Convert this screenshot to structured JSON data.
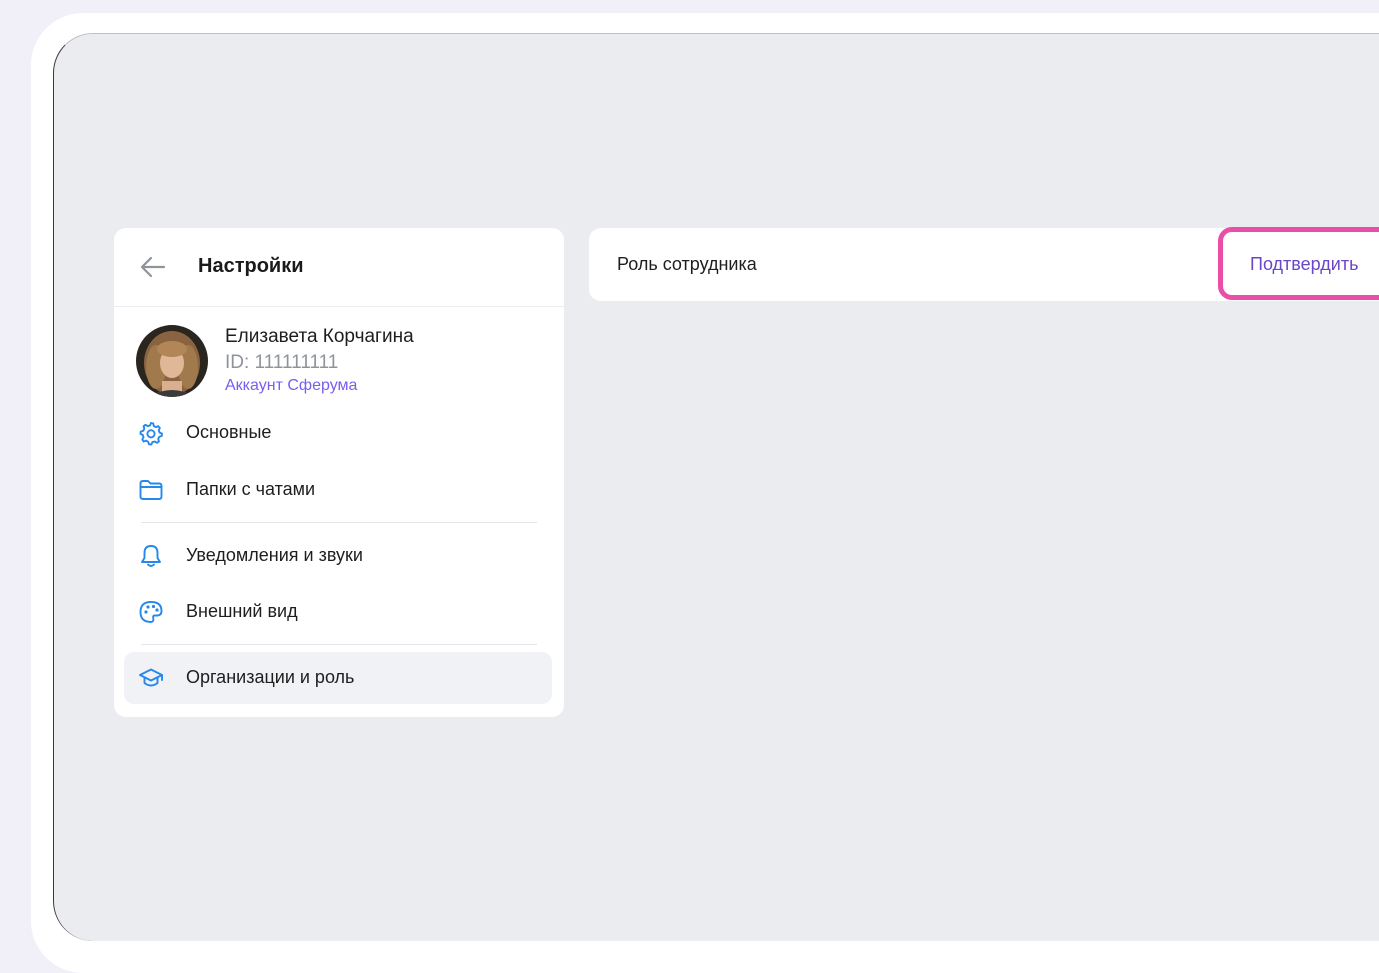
{
  "settings": {
    "title": "Настройки",
    "profile": {
      "name": "Елизавета Корчагина",
      "id": "ID: 111111111",
      "account": "Аккаунт Сферума"
    },
    "menu": [
      {
        "label": "Основные",
        "icon": "gear-icon"
      },
      {
        "label": "Папки с чатами",
        "icon": "folder-icon"
      },
      {
        "label": "Уведомления и звуки",
        "icon": "bell-icon"
      },
      {
        "label": "Внешний вид",
        "icon": "palette-icon"
      },
      {
        "label": "Организации и роль",
        "icon": "graduation-cap-icon",
        "active": true
      }
    ]
  },
  "role": {
    "label": "Роль сотрудника",
    "confirm": "Подтвердить"
  },
  "colors": {
    "accent": "#2688eb",
    "link": "#7a5cf0",
    "highlight": "#ea4fa8",
    "screen_bg": "#ebecf0"
  }
}
